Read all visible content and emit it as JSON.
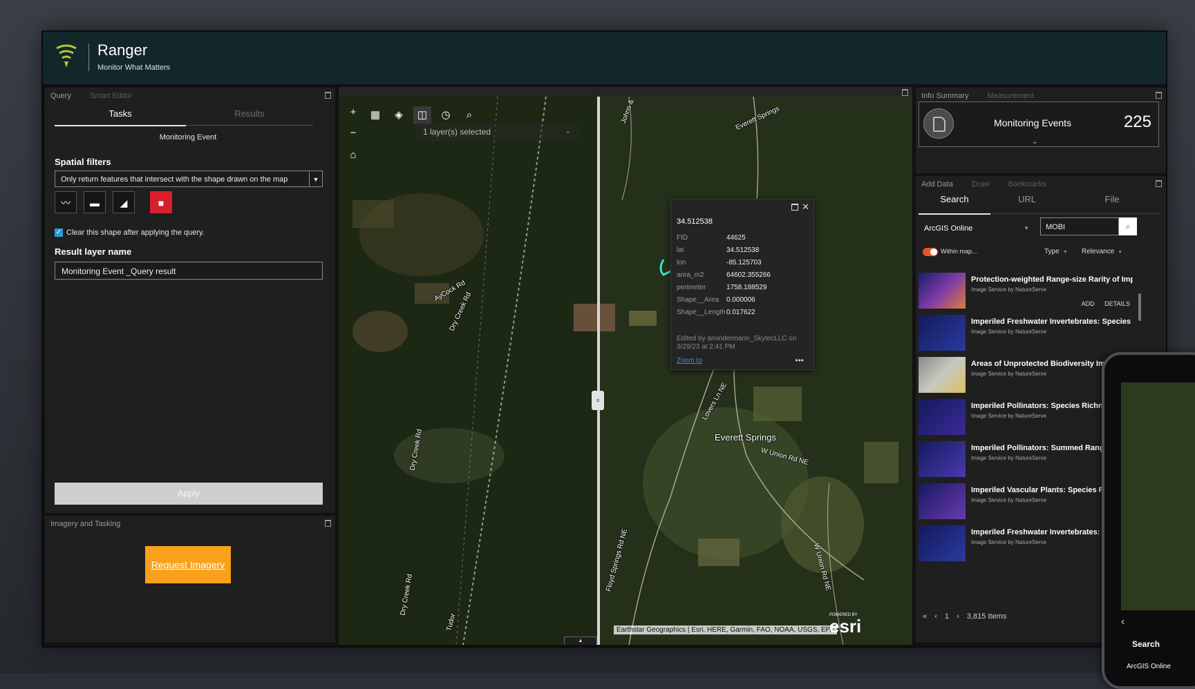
{
  "header": {
    "title": "Ranger",
    "subtitle": "Monitor What Matters"
  },
  "query_panel": {
    "tabs": [
      "Query",
      "Smart Editor"
    ],
    "subtabs": [
      "Tasks",
      "Results"
    ],
    "layer": "Monitoring Event",
    "spatial_filters_label": "Spatial filters",
    "spatial_filter_value": "Only return features that intersect with the shape drawn on the map",
    "clear_shape_label": "Clear this shape after applying the query.",
    "result_layer_label": "Result layer name",
    "result_layer_value": "Monitoring Event _Query result",
    "apply_label": "Apply"
  },
  "imagery_panel": {
    "title": "Imagery and Tasking",
    "button_label": "Request Imagery"
  },
  "map": {
    "layer_selector": "1 layer(s) selected",
    "labels": {
      "aycock": "AyCock Rd",
      "dry_creek_1": "Dry Creek Rd",
      "dry_creek_2": "Dry Creek Rd",
      "dry_creek_3": "Dry Creek Rd",
      "johns": "Johns &",
      "everett_springs": "Everett Springs",
      "everett_springs_place": "Everett Springs",
      "lovers_ln": "Lovers Ln NE",
      "w_union": "W Union Rd NE",
      "union_rd": "W Union Rd NE",
      "floyd_springs": "Floyd Springs Rd NE",
      "tudor": "Tudor"
    },
    "attribution": "Earthstar Geographics | Esri, HERE, Garmin, FAO, NOAA, USGS, EPA",
    "esri_powered": "POWERED BY",
    "esri": "esri",
    "popup": {
      "title": "34.512538",
      "fields": [
        {
          "key": "FID",
          "value": "44625"
        },
        {
          "key": "lat",
          "value": "34.512538"
        },
        {
          "key": "lon",
          "value": "-85.125703"
        },
        {
          "key": "area_m2",
          "value": "64602.355266"
        },
        {
          "key": "perimeter",
          "value": "1758.188529"
        },
        {
          "key": "Shape__Area",
          "value": "0.000006"
        },
        {
          "key": "Shape__Length",
          "value": "0.017622"
        }
      ],
      "edited": "Edited by amindermann_SkytecLLC on 3/29/23 at 2:41 PM",
      "zoom_to": "Zoom to",
      "more": "•••"
    }
  },
  "info_panel": {
    "tabs": [
      "Info Summary",
      "Measurement"
    ],
    "label": "Monitoring Events",
    "count": "225"
  },
  "data_panel": {
    "tabs": [
      "Add Data",
      "Draw",
      "Bookmarks"
    ],
    "subtabs": [
      "Search",
      "URL",
      "File"
    ],
    "source": "ArcGIS Online",
    "search_value": "MOBI",
    "within_map": "Within map...",
    "type_label": "Type",
    "relevance_label": "Relevance",
    "results": [
      {
        "title": "Protection-weighted Range-size Rarity of Imperiled...",
        "sub": "Image Service by NatureServe",
        "add": "ADD",
        "details": "DETAILS"
      },
      {
        "title": "Imperiled Freshwater Invertebrates: Species Richness",
        "sub": "Image Service by NatureServe"
      },
      {
        "title": "Areas of Unprotected Biodiversity Importance",
        "sub": "Image Service by NatureServe"
      },
      {
        "title": "Imperiled Pollinators: Species Richness",
        "sub": "Image Service by NatureServe"
      },
      {
        "title": "Imperiled Pollinators: Summed Range-size Rarity",
        "sub": "Image Service by NatureServe"
      },
      {
        "title": "Imperiled Vascular Plants: Species Richness",
        "sub": "Image Service by NatureServe"
      },
      {
        "title": "Imperiled Freshwater Invertebrates: Summed",
        "sub": "Image Service by NatureServe"
      }
    ],
    "pager_page": "1",
    "pager_items": "3,815 Items"
  },
  "phone": {
    "search_label": "Search",
    "source": "ArcGIS Online"
  },
  "colors": {
    "header_bg": "#13272a",
    "accent_orange": "#f9a11b",
    "delete_red": "#d8202c",
    "link_blue": "#3b8fd6",
    "toggle_orange": "#e8572b"
  }
}
